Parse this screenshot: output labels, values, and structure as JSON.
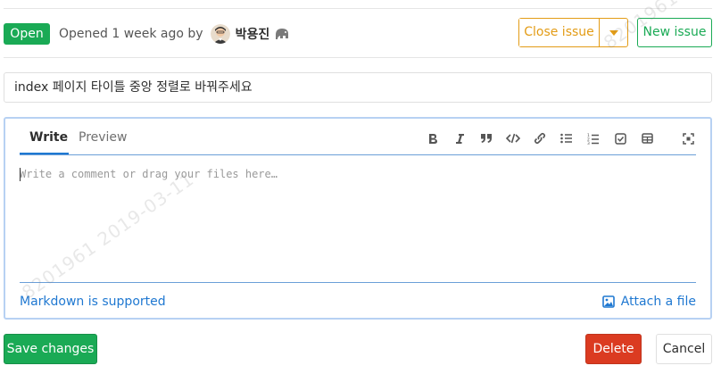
{
  "header": {
    "status": "Open",
    "opened_text": "Opened 1 week ago by",
    "author": "박용진",
    "close_label": "Close issue",
    "new_issue_label": "New issue"
  },
  "title_input": {
    "value": "index 페이지 타이틀 중앙 정렬로 바꿔주세요"
  },
  "editor": {
    "tabs": [
      {
        "label": "Write",
        "active": true
      },
      {
        "label": "Preview",
        "active": false
      }
    ],
    "toolbar_icons": [
      "bold-icon",
      "italic-icon",
      "quote-icon",
      "code-icon",
      "link-icon",
      "bullet-list-icon",
      "numbered-list-icon",
      "task-list-icon",
      "table-icon",
      "fullscreen-icon"
    ],
    "placeholder": "Write a comment or drag your files here…",
    "markdown_link": "Markdown is supported",
    "attach_label": "Attach a file"
  },
  "actions": {
    "save_label": "Save changes",
    "delete_label": "Delete",
    "cancel_label": "Cancel"
  },
  "watermark": "8201961 2019-03-11",
  "colors": {
    "success": "#1aaa55",
    "warning": "#e39c16",
    "danger": "#db3b21",
    "link": "#1f78d1",
    "focus_border": "#b7d1f3"
  }
}
